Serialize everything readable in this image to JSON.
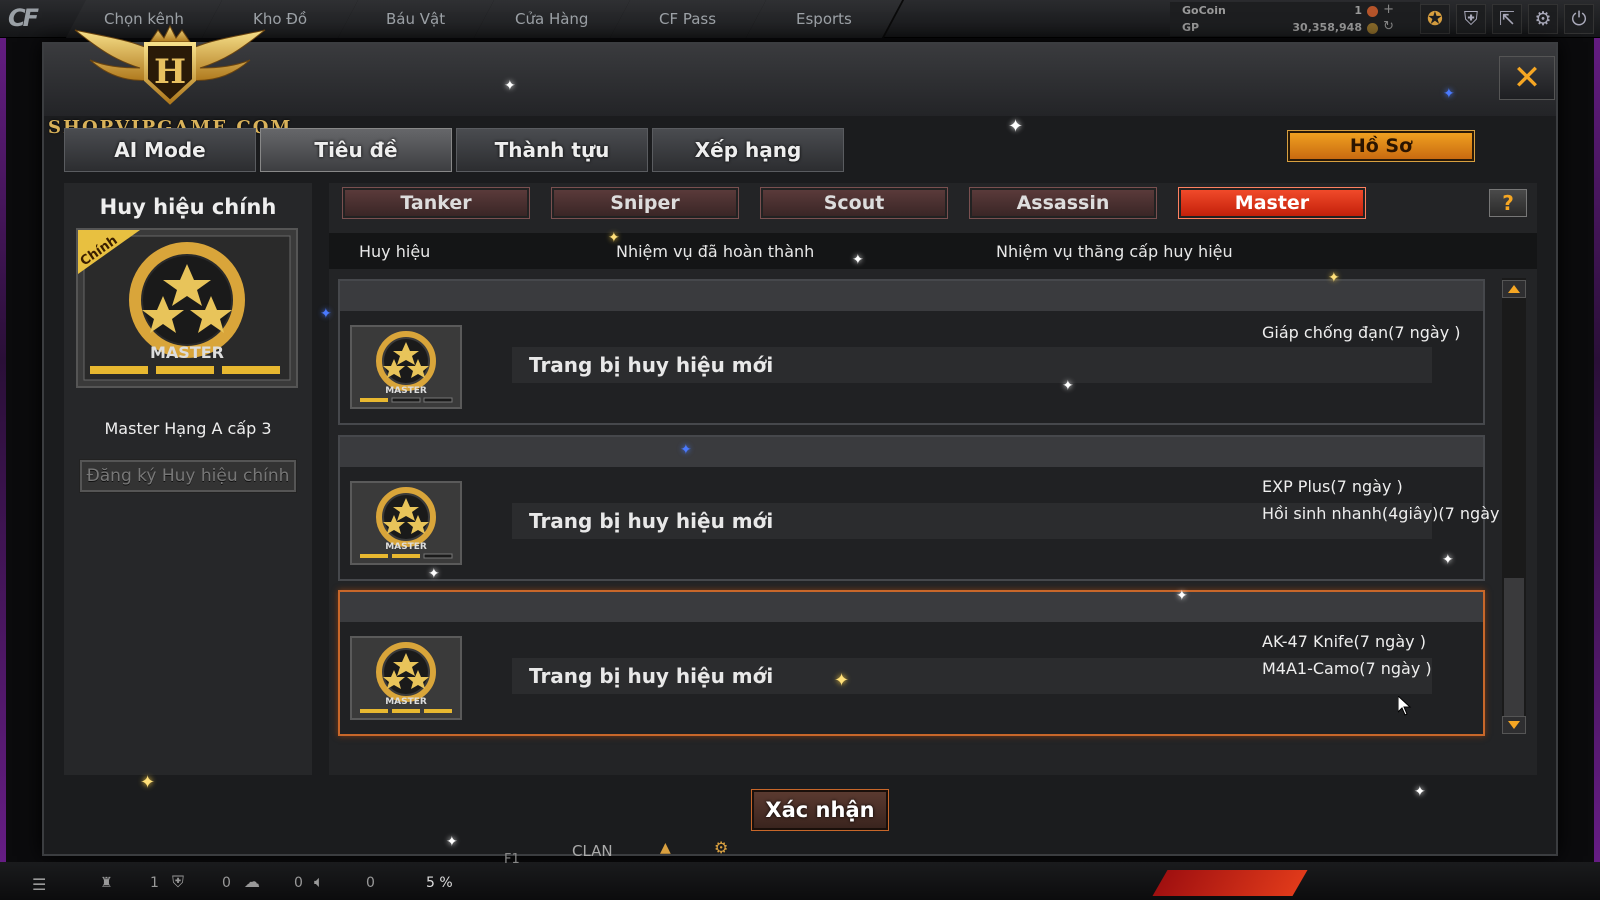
{
  "topbar": {
    "tabs": [
      "Chọn kênh",
      "Kho Đồ",
      "Báu Vật",
      "Cửa Hàng",
      "CF Pass",
      "Esports"
    ],
    "wallet": {
      "gocoin_label": "GoCoin",
      "gocoin_value": "1",
      "gp_label": "GP",
      "gp_value": "30,358,948"
    }
  },
  "watermark": {
    "letter": "H",
    "text": "SHOPVIPGAME.COM"
  },
  "dialog": {
    "main_tabs": [
      "AI Mode",
      "Tiêu đề",
      "Thành tựu",
      "Xếp hạng"
    ],
    "active_main_tab": "Tiêu đề",
    "profile_button": "Hồ Sơ",
    "close_symbol": "✕"
  },
  "left_panel": {
    "title": "Huy hiệu chính",
    "badge": {
      "ribbon": "Chính",
      "label": "MASTER"
    },
    "badge_name": "Master Hạng A cấp 3",
    "register_button": "Đăng ký Huy hiệu chính"
  },
  "class_tabs": [
    "Tanker",
    "Sniper",
    "Scout",
    "Assassin",
    "Master"
  ],
  "active_class_tab": "Master",
  "help_symbol": "?",
  "columns": {
    "badge": "Huy hiệu",
    "completed": "Nhiệm vụ đã hoàn thành",
    "upgrade": "Nhiệm vụ thăng cấp huy hiệu"
  },
  "rows": [
    {
      "badge_label": "MASTER",
      "mission": "Trang bị huy hiệu mới",
      "rewards": [
        "Giáp chống đạn(7 ngày )"
      ]
    },
    {
      "badge_label": "MASTER",
      "mission": "Trang bị huy hiệu mới",
      "rewards": [
        "EXP Plus(7 ngày )",
        "Hồi sinh nhanh(4giây)(7 ngày"
      ]
    },
    {
      "badge_label": "MASTER",
      "mission": "Trang bị huy hiệu mới",
      "rewards": [
        "AK-47 Knife(7 ngày )",
        "M4A1-Camo(7 ngày )"
      ]
    }
  ],
  "confirm_button": "Xác nhận",
  "bottombar": {
    "count1": "1",
    "count2": "0",
    "count3": "0",
    "count4": "0",
    "percent": "5 %",
    "f1": "F1",
    "clan": "CLAN"
  }
}
